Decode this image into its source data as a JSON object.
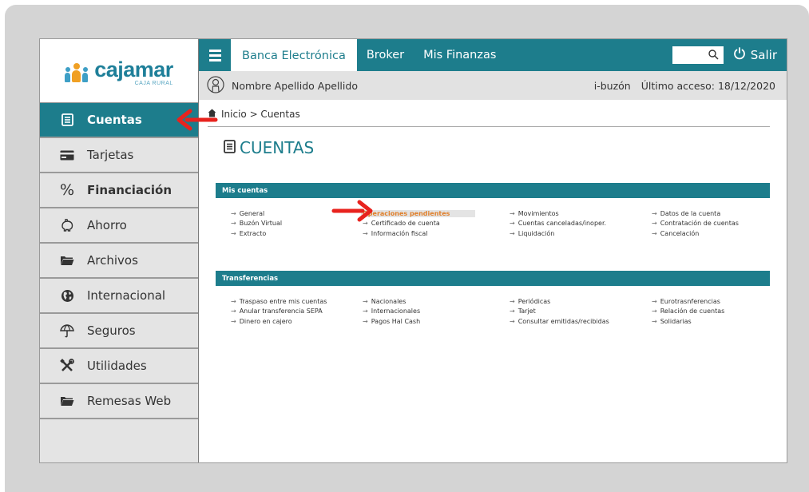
{
  "brand": {
    "name": "cajamar",
    "sub": "CAJA RURAL",
    "teal": "#1d7d8c",
    "orange_accent": "#f0a024",
    "highlight_text": "#e0802c",
    "annotation_red": "#e8231e"
  },
  "sidebar": {
    "items": [
      {
        "label": "Cuentas",
        "icon": "statement-icon",
        "active": true
      },
      {
        "label": "Tarjetas",
        "icon": "card-icon"
      },
      {
        "label": "Financiación",
        "icon": "percent-icon",
        "bold": true
      },
      {
        "label": "Ahorro",
        "icon": "piggy-bank-icon"
      },
      {
        "label": "Archivos",
        "icon": "folder-icon"
      },
      {
        "label": "Internacional",
        "icon": "globe-icon"
      },
      {
        "label": "Seguros",
        "icon": "umbrella-icon"
      },
      {
        "label": "Utilidades",
        "icon": "tools-icon"
      },
      {
        "label": "Remesas Web",
        "icon": "folder-icon"
      }
    ]
  },
  "topbar": {
    "tabs": [
      {
        "label": "Banca Electrónica",
        "active": true
      },
      {
        "label": "Broker"
      },
      {
        "label": "Mis Finanzas"
      }
    ],
    "search_placeholder": "",
    "logout_label": "Salir"
  },
  "subbar": {
    "user_name": "Nombre Apellido Apellido",
    "inbox": "i-buzón",
    "last_access": "Último acceso: 18/12/2020"
  },
  "breadcrumb": "Inicio > Cuentas",
  "page_title": "CUENTAS",
  "sections": [
    {
      "title": "Mis cuentas",
      "rows": [
        [
          "General",
          "Operaciones pendientes",
          "Movimientos",
          "Datos de la cuenta"
        ],
        [
          "Buzón Virtual",
          "Certificado de cuenta",
          "Cuentas canceladas/inoper.",
          "Contratación de cuentas"
        ],
        [
          "Extracto",
          "Información fiscal",
          "Liquidación",
          "Cancelación"
        ]
      ],
      "highlighted": "Operaciones pendientes"
    },
    {
      "title": "Transferencias",
      "rows": [
        [
          "Traspaso entre mis cuentas",
          "Nacionales",
          "Periódicas",
          "Eurotrasnferencias"
        ],
        [
          "Anular transferencia SEPA",
          "Internacionales",
          "Tarjet",
          "Relación de cuentas"
        ],
        [
          "Dinero en cajero",
          "Pagos Hal Cash",
          "Consultar emitidas/recibidas",
          "Solidarias"
        ]
      ]
    }
  ]
}
